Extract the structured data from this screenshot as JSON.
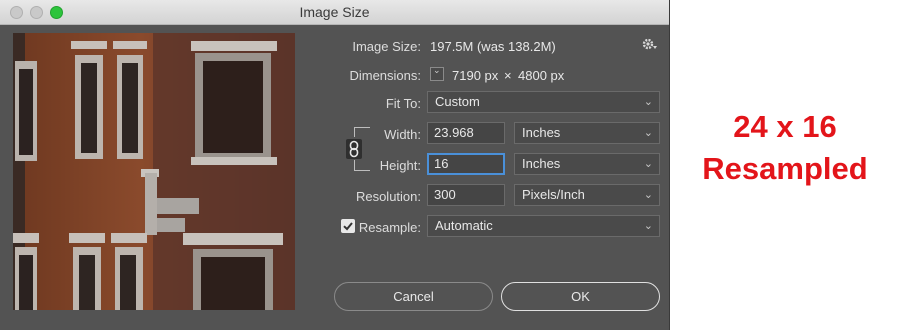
{
  "window": {
    "title": "Image Size"
  },
  "image_size": {
    "label": "Image Size:",
    "value": "197.5M (was 138.2M)"
  },
  "dimensions": {
    "label": "Dimensions:",
    "width_px": "7190 px",
    "times": "×",
    "height_px": "4800 px"
  },
  "fit_to": {
    "label": "Fit To:",
    "value": "Custom"
  },
  "width": {
    "label": "Width:",
    "value": "23.968",
    "unit": "Inches"
  },
  "height": {
    "label": "Height:",
    "value": "16",
    "unit": "Inches"
  },
  "resolution": {
    "label": "Resolution:",
    "value": "300",
    "unit": "Pixels/Inch"
  },
  "resample": {
    "label": "Resample:",
    "checked": true,
    "value": "Automatic"
  },
  "buttons": {
    "cancel": "Cancel",
    "ok": "OK"
  },
  "annotation": {
    "line1": "24 x 16",
    "line2": "Resampled"
  },
  "colors": {
    "annotation": "#e3151a",
    "dialog_bg": "#535353",
    "focus": "#4a90d9"
  },
  "icons": {
    "settings": "gear-icon",
    "link": "chain-link-icon",
    "dimensions_menu": "chevron-down-icon"
  }
}
